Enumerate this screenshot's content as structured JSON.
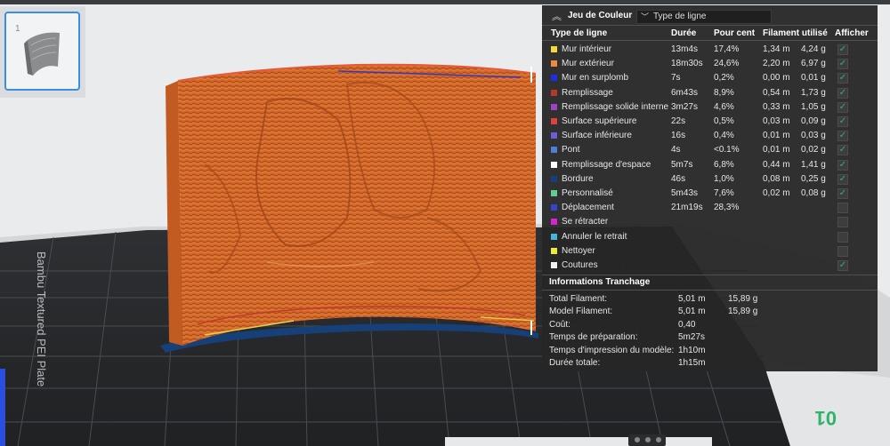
{
  "thumbnail": {
    "number": "1"
  },
  "plate": {
    "label": "Bambu Textured PEI Plate",
    "plate_number": "01"
  },
  "legend": {
    "title": "Jeu de Couleur",
    "view_select": "Type de ligne",
    "columns": {
      "type": "Type de ligne",
      "duration": "Durée",
      "percent": "Pour cent",
      "filament": "Filament utilisé",
      "show": "Afficher"
    },
    "rows": [
      {
        "name": "Mur intérieur",
        "color": "#f2d83a",
        "duration": "13m4s",
        "percent": "17,4%",
        "length": "1,34 m",
        "weight": "4,24 g",
        "checked": true
      },
      {
        "name": "Mur extérieur",
        "color": "#ef8a3c",
        "duration": "18m30s",
        "percent": "24,6%",
        "length": "2,20 m",
        "weight": "6,97 g",
        "checked": true
      },
      {
        "name": "Mur en surplomb",
        "color": "#1e2ee8",
        "duration": "7s",
        "percent": "0,2%",
        "length": "0,00 m",
        "weight": "0,01 g",
        "checked": true
      },
      {
        "name": "Remplissage",
        "color": "#b03a2e",
        "duration": "6m43s",
        "percent": "8,9%",
        "length": "0,54 m",
        "weight": "1,73 g",
        "checked": true
      },
      {
        "name": "Remplissage solide interne",
        "color": "#9a45c4",
        "duration": "3m27s",
        "percent": "4,6%",
        "length": "0,33 m",
        "weight": "1,05 g",
        "checked": true
      },
      {
        "name": "Surface supérieure",
        "color": "#e04040",
        "duration": "22s",
        "percent": "0,5%",
        "length": "0,03 m",
        "weight": "0,09 g",
        "checked": true
      },
      {
        "name": "Surface inférieure",
        "color": "#6a5fd6",
        "duration": "16s",
        "percent": "0,4%",
        "length": "0,01 m",
        "weight": "0,03 g",
        "checked": true
      },
      {
        "name": "Pont",
        "color": "#4f7fd4",
        "duration": "4s",
        "percent": "<0.1%",
        "length": "0,01 m",
        "weight": "0,02 g",
        "checked": true
      },
      {
        "name": "Remplissage d'espace",
        "color": "#ffffff",
        "duration": "5m7s",
        "percent": "6,8%",
        "length": "0,44 m",
        "weight": "1,41 g",
        "checked": true
      },
      {
        "name": "Bordure",
        "color": "#173f78",
        "duration": "46s",
        "percent": "1,0%",
        "length": "0,08 m",
        "weight": "0,25 g",
        "checked": true
      },
      {
        "name": "Personnalisé",
        "color": "#5ecf8f",
        "duration": "5m43s",
        "percent": "7,6%",
        "length": "0,02 m",
        "weight": "0,08 g",
        "checked": true
      },
      {
        "name": "Déplacement",
        "color": "#3346c8",
        "duration": "21m19s",
        "percent": "28,3%",
        "length": "",
        "weight": "",
        "checked": false
      },
      {
        "name": "Se rétracter",
        "color": "#d424d4",
        "duration": "",
        "percent": "",
        "length": "",
        "weight": "",
        "checked": false
      },
      {
        "name": "Annuler le retrait",
        "color": "#46b4d8",
        "duration": "",
        "percent": "",
        "length": "",
        "weight": "",
        "checked": false
      },
      {
        "name": "Nettoyer",
        "color": "#ece93a",
        "duration": "",
        "percent": "",
        "length": "",
        "weight": "",
        "checked": false
      },
      {
        "name": "Coutures",
        "color": "#f2f2f2",
        "duration": "",
        "percent": "",
        "length": "",
        "weight": "",
        "checked": true
      }
    ],
    "info": {
      "title": "Informations Tranchage",
      "rows": [
        {
          "label": "Total Filament:",
          "v1": "5,01 m",
          "v2": "15,89 g"
        },
        {
          "label": "Model Filament:",
          "v1": "5,01 m",
          "v2": "15,89 g"
        },
        {
          "label": "Coût:",
          "v1": "0,40",
          "v2": ""
        },
        {
          "label": "Temps de préparation:",
          "v1": "5m27s",
          "v2": ""
        },
        {
          "label": "Temps d'impression du modèle:",
          "v1": "1h10m",
          "v2": ""
        },
        {
          "label": "Durée totale:",
          "v1": "1h15m",
          "v2": ""
        }
      ]
    }
  },
  "colors": {
    "wall": "#d76c2a",
    "bed": "#2b2d30",
    "brim": "#173f78",
    "checkmark": "#2fb46b",
    "plate_number": "#2fb46b",
    "selection": "#3a8ee8"
  }
}
